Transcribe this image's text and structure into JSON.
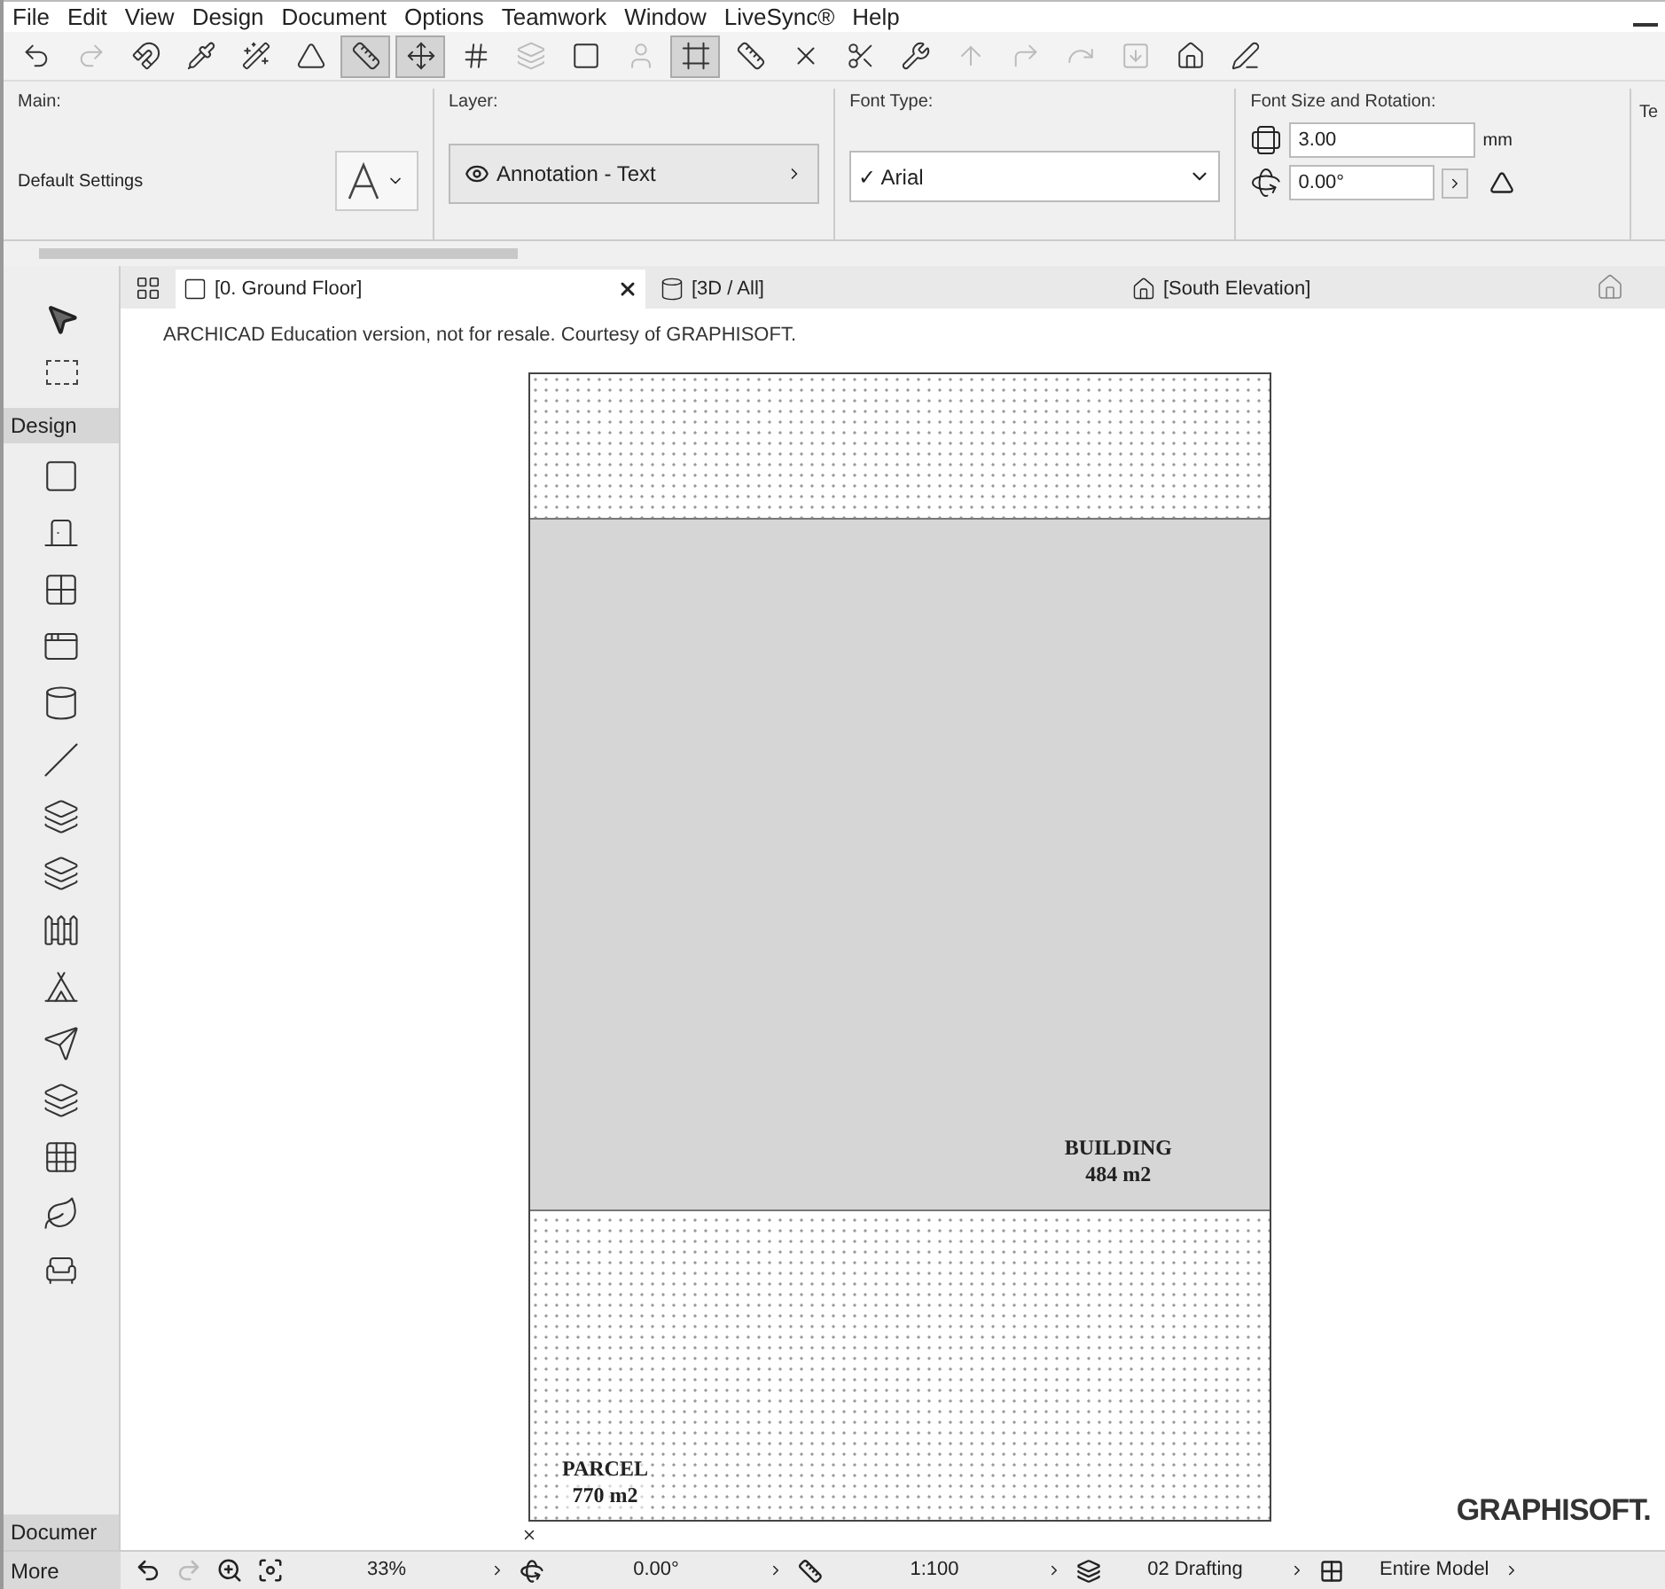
{
  "menu": [
    "File",
    "Edit",
    "View",
    "Design",
    "Document",
    "Options",
    "Teamwork",
    "Window",
    "LiveSync®",
    "Help"
  ],
  "toolbar": [
    {
      "pressed": false,
      "disabled": false
    },
    {
      "pressed": false,
      "disabled": true
    },
    {
      "pressed": false,
      "disabled": false
    },
    {
      "pressed": false,
      "disabled": false
    },
    {
      "pressed": false,
      "disabled": false
    },
    {
      "pressed": false,
      "disabled": false
    },
    {
      "pressed": true,
      "disabled": false
    },
    {
      "pressed": true,
      "disabled": false
    },
    {
      "pressed": false,
      "disabled": false
    },
    {
      "pressed": false,
      "disabled": true
    },
    {
      "pressed": false,
      "disabled": false
    },
    {
      "pressed": false,
      "disabled": true
    },
    {
      "pressed": true,
      "disabled": false
    },
    {
      "pressed": false,
      "disabled": false
    },
    {
      "pressed": false,
      "disabled": false
    },
    {
      "pressed": false,
      "disabled": false
    },
    {
      "pressed": false,
      "disabled": false
    },
    {
      "pressed": false,
      "disabled": true
    },
    {
      "pressed": false,
      "disabled": true
    },
    {
      "pressed": false,
      "disabled": true
    },
    {
      "pressed": false,
      "disabled": true
    },
    {
      "pressed": false,
      "disabled": false
    },
    {
      "pressed": false,
      "disabled": false
    }
  ],
  "info_box": {
    "main_label": "Main:",
    "main_value": "Default Settings",
    "layer_label": "Layer:",
    "layer_value": "Annotation - Text",
    "font_label": "Font Type:",
    "font_value": "✓ Arial",
    "size_label": "Font Size and Rotation:",
    "size_value": "3.00",
    "size_unit": "mm",
    "rotation_value": "0.00°",
    "cut_label": "Te"
  },
  "tabs": [
    {
      "label": "[0. Ground Floor]",
      "selected": true
    },
    {
      "label": "[3D / All]",
      "selected": false
    },
    {
      "label": "[South Elevation]",
      "selected": false
    }
  ],
  "toolbox": {
    "design_label": "Design",
    "document_label": "Documer"
  },
  "canvas": {
    "notice": "ARCHICAD Education version, not for resale. Courtesy of GRAPHISOFT.",
    "building_name": "BUILDING",
    "building_area": "484 m2",
    "parcel_name": "PARCEL",
    "parcel_area": "770 m2",
    "logo": "GRAPHISOFT."
  },
  "status_bar": {
    "more": "More",
    "zoom": "33%",
    "angle": "0.00°",
    "scale": "1:100",
    "layer_combo": "02 Drafting",
    "model_view": "Entire Model"
  }
}
